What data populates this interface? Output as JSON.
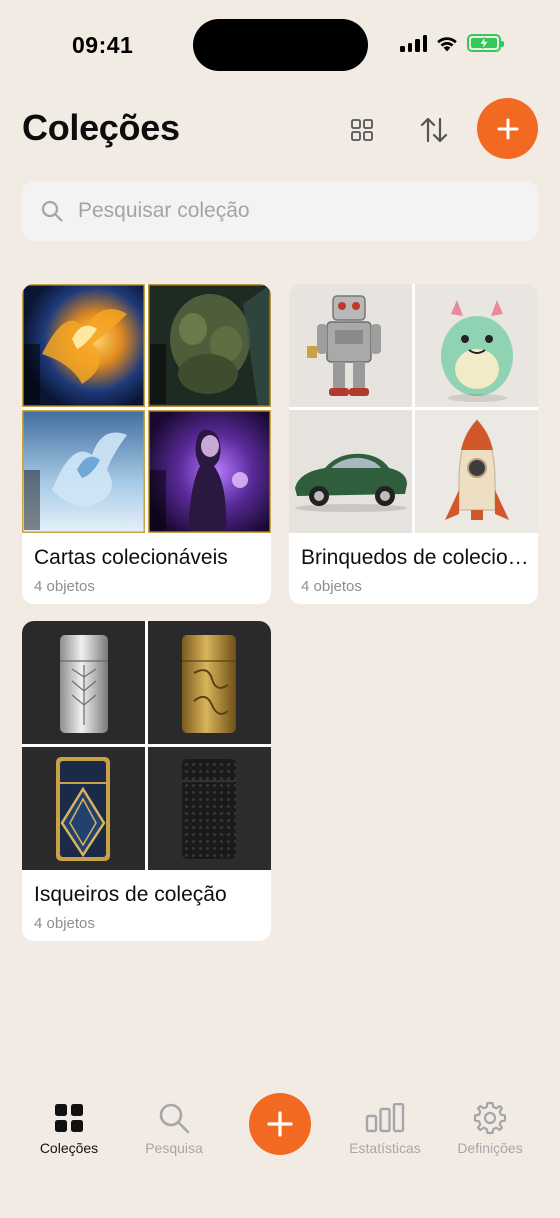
{
  "status_bar": {
    "time": "09:41"
  },
  "header": {
    "title": "Coleções"
  },
  "search": {
    "placeholder": "Pesquisar coleção"
  },
  "collections": [
    {
      "name": "Cartas colecionáveis",
      "count": "4 objetos",
      "thumbs": [
        "phoenix-card",
        "golem-card",
        "ice-dragon-card",
        "sorceress-card"
      ]
    },
    {
      "name": "Brinquedos de colecionador",
      "count": "4 objetos",
      "thumbs": [
        "tin-robot",
        "vinyl-monster",
        "green-sports-car",
        "retro-rocket"
      ]
    },
    {
      "name": "Isqueiros de coleção",
      "count": "4 objetos",
      "thumbs": [
        "silver-art-deco-lighter",
        "gold-engraved-lighter",
        "blue-gold-lighter",
        "black-textured-lighter"
      ]
    }
  ],
  "tabbar": {
    "items": [
      {
        "label": "Coleções",
        "icon": "grid-icon",
        "active": true
      },
      {
        "label": "Pesquisa",
        "icon": "search-icon"
      },
      {
        "label": "Estatísticas",
        "icon": "bar-chart-icon"
      },
      {
        "label": "Definições",
        "icon": "gear-icon"
      }
    ]
  },
  "colors": {
    "accent": "#F26A22",
    "background": "#F1EBE3",
    "battery": "#34C759"
  }
}
